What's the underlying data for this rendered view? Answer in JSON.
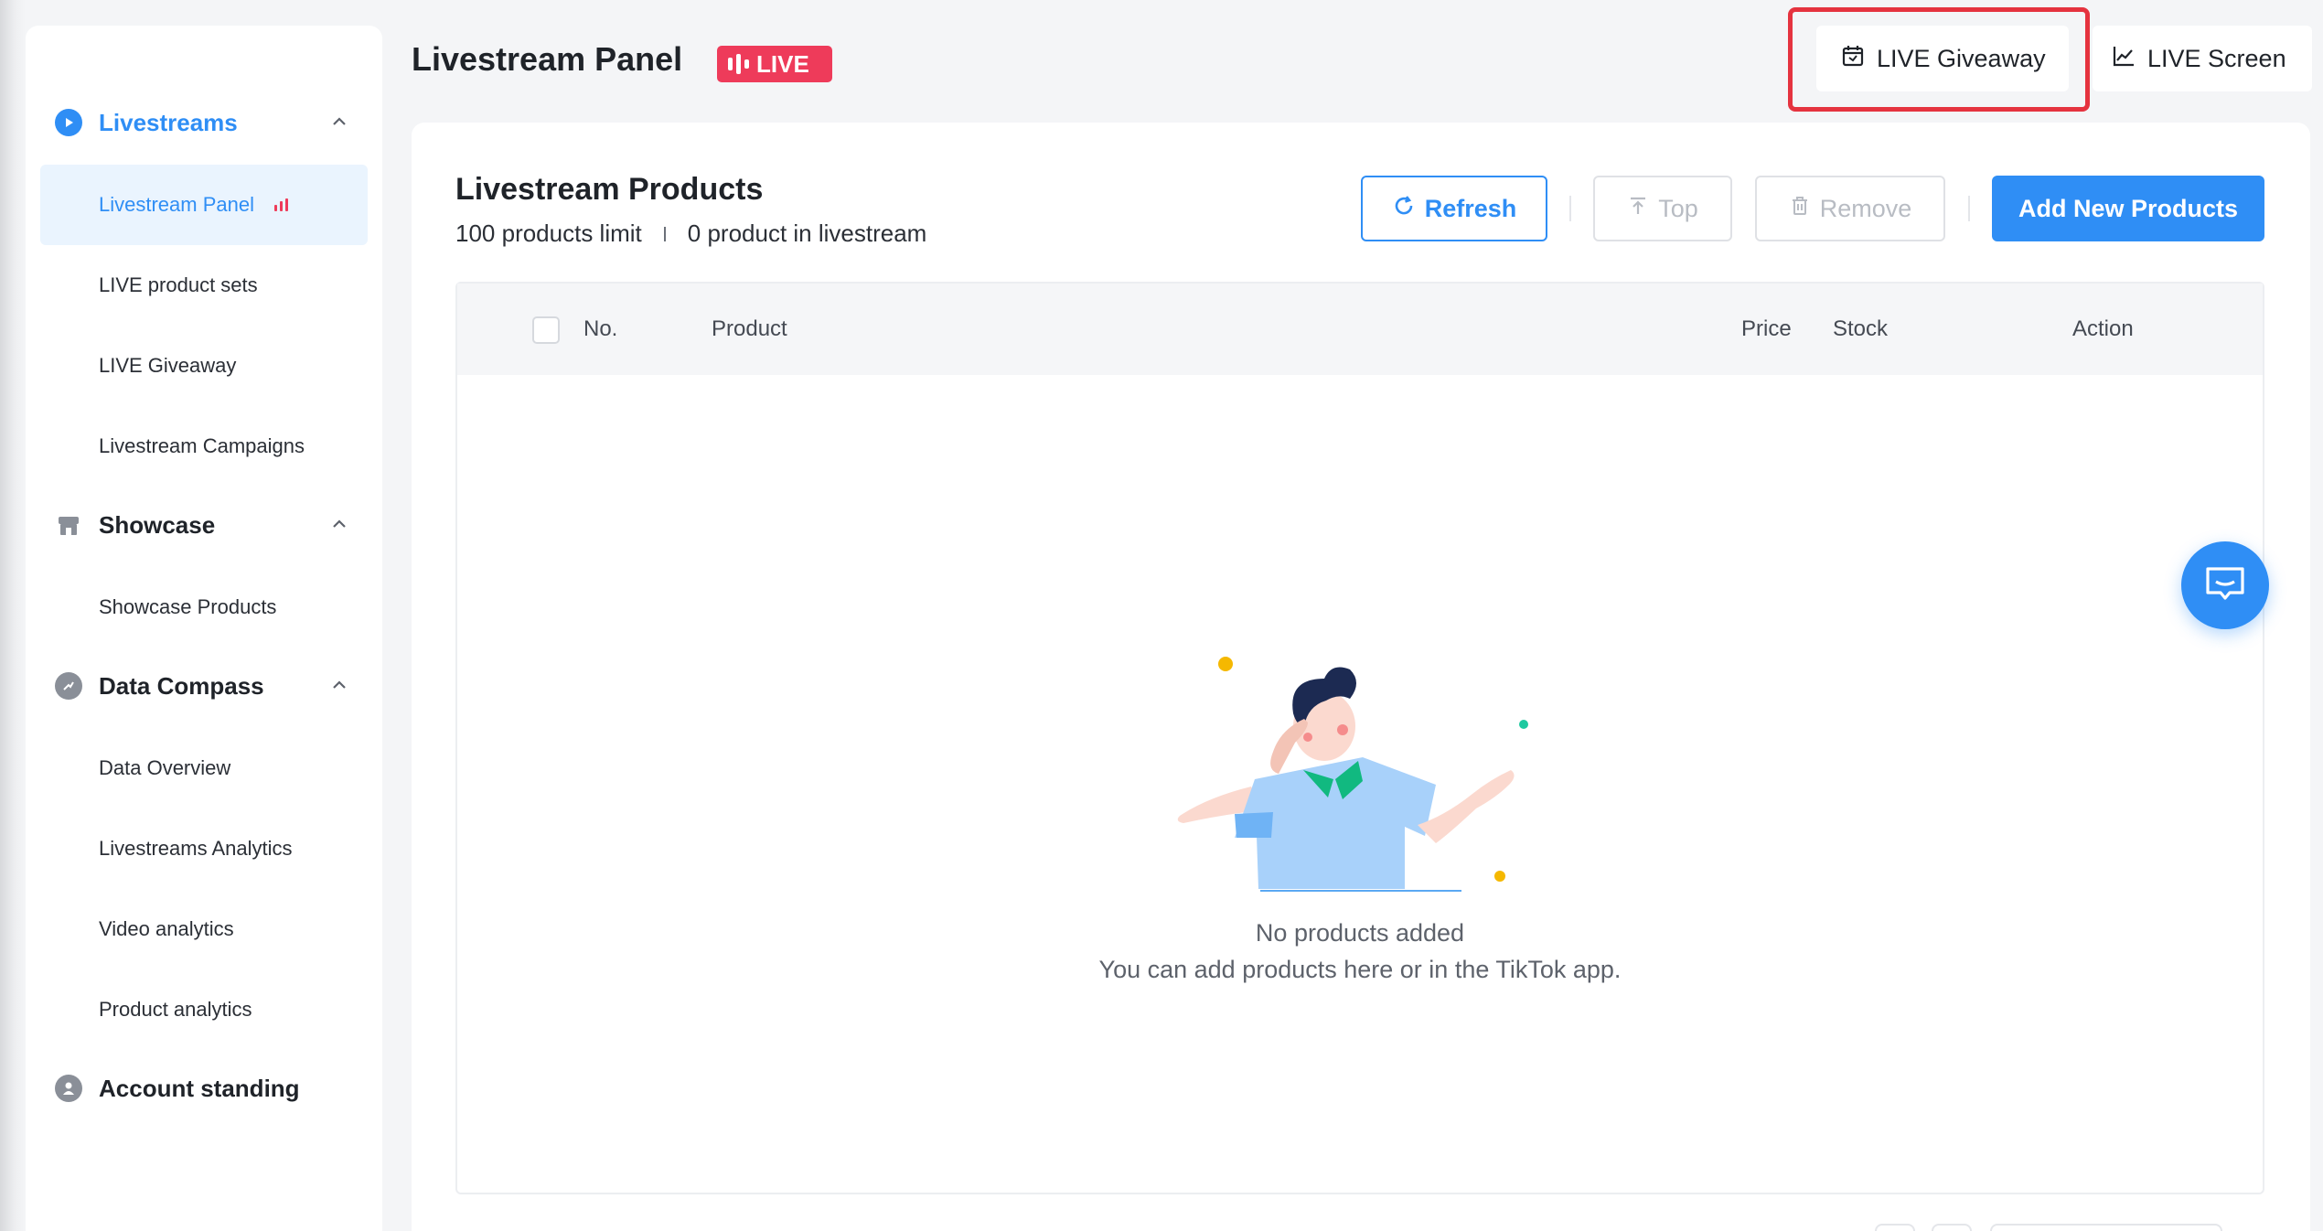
{
  "sidebar": {
    "groups": [
      {
        "label": "Livestreams",
        "icon": "play-circle-icon",
        "expanded": true
      },
      {
        "label": "Showcase",
        "icon": "store-icon",
        "expanded": true
      },
      {
        "label": "Data Compass",
        "icon": "compass-icon",
        "expanded": true
      },
      {
        "label": "Account standing",
        "icon": "user-shield-icon"
      }
    ],
    "livestream_items": [
      "Livestream Panel",
      "LIVE product sets",
      "LIVE Giveaway",
      "Livestream Campaigns"
    ],
    "showcase_items": [
      "Showcase Products"
    ],
    "data_items": [
      "Data Overview",
      "Livestreams Analytics",
      "Video analytics",
      "Product analytics"
    ],
    "active_item": "Livestream Panel"
  },
  "header": {
    "title": "Livestream Panel",
    "badge": "LIVE",
    "giveaway_button": "LIVE Giveaway",
    "screen_button": "LIVE Screen"
  },
  "products": {
    "title": "Livestream Products",
    "limit_text": "100 products limit",
    "count_text": "0 product in livestream",
    "buttons": {
      "refresh": "Refresh",
      "top": "Top",
      "remove": "Remove",
      "add": "Add New Products"
    },
    "columns": [
      "No.",
      "Product",
      "Price",
      "Stock",
      "Action"
    ],
    "empty_title": "No products added",
    "empty_desc": "You can add products here or in the TikTok app."
  },
  "colors": {
    "accent": "#2f8ef5",
    "live_red": "#ee3b5a",
    "highlight": "#e5333f"
  }
}
